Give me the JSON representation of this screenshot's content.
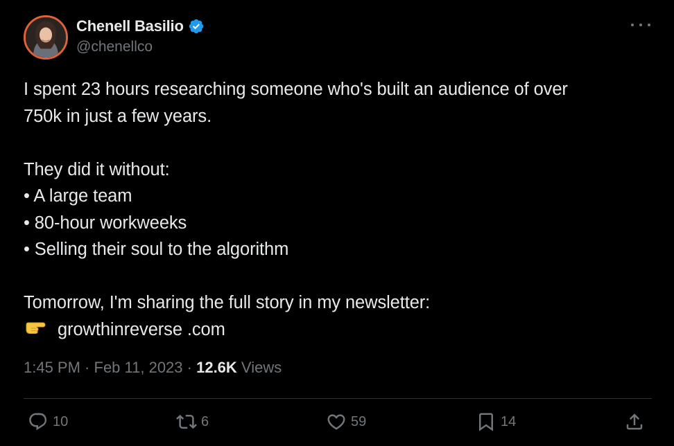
{
  "author": {
    "display_name": "Chenell Basilio",
    "handle": "@chenellco",
    "verified": true,
    "avatar_ring_color": "#e0623a"
  },
  "tweet": {
    "lines": [
      "I spent 23 hours researching someone who's built an audience of over",
      "750k in just a few years.",
      "",
      "They did it without:",
      "• A large team",
      "• 80-hour workweeks",
      "• Selling their soul to the algorithm",
      "",
      "Tomorrow, I'm sharing the full story in my newsletter:"
    ],
    "link_emoji": "pointing-right-hand",
    "link_text": "growthinreverse .com"
  },
  "meta": {
    "time": "1:45 PM",
    "separator1": " · ",
    "date": "Feb 11, 2023",
    "separator2": " · ",
    "views_count": "12.6K",
    "views_label": " Views"
  },
  "actions": {
    "replies": "10",
    "retweets": "6",
    "likes": "59",
    "bookmarks": "14"
  },
  "colors": {
    "background": "#000000",
    "text": "#e7e9ea",
    "secondary": "#71767b",
    "verified_badge": "#1d9bf0",
    "divider": "#2f3336"
  }
}
